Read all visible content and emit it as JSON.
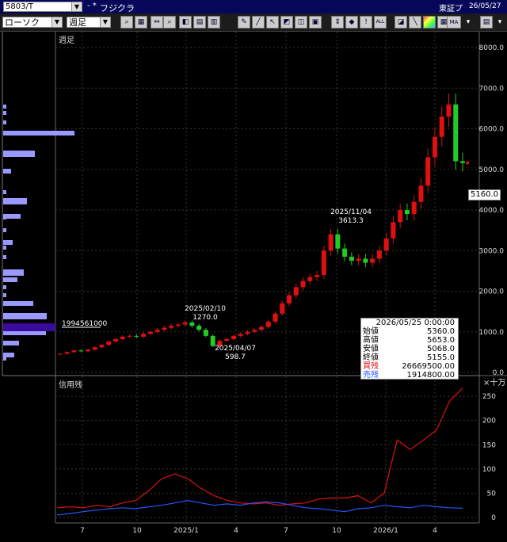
{
  "window": {
    "code": "5803/T",
    "marker": "- *",
    "company": "フジクラ",
    "exchange": "東証プ",
    "date": "26/05/27"
  },
  "toolbar": {
    "chart_type": "ローソク",
    "period": "週足",
    "extra_btn1": "MA"
  },
  "colors": {
    "background": "#000000",
    "up_candle": "#e01010",
    "down_candle": "#22cc22",
    "grid": "#333333",
    "sell_balance_line": "#e01010",
    "buy_balance_line": "#2255ff",
    "volume_profile": "#9999ff",
    "volume_profile_highlight": "#3a0a9a"
  },
  "main_chart": {
    "label": "週足",
    "y_ticks": [
      "8000.0",
      "7000.0",
      "6000.0",
      "5000.0",
      "4000.0",
      "3000.0",
      "2000.0",
      "1000.0",
      "0.0"
    ],
    "current_price": "5160.0",
    "volume_profile_value": "1994561000",
    "annotations": [
      {
        "date": "2025/02/10",
        "price": "1270.0"
      },
      {
        "date": "2025/04/07",
        "price": "598.7"
      },
      {
        "date": "2025/11/04",
        "price": "3613.3"
      }
    ]
  },
  "ohlc_box": {
    "date": "2026/05/25 0:00:00",
    "rows": [
      {
        "label": "始値",
        "value": "5360.0",
        "color": "#000000"
      },
      {
        "label": "高値",
        "value": "5653.0",
        "color": "#000000"
      },
      {
        "label": "安値",
        "value": "5068.0",
        "color": "#000000"
      },
      {
        "label": "終値",
        "value": "5155.0",
        "color": "#000000"
      },
      {
        "label": "買残",
        "value": "26669500.00",
        "color": "#e01010"
      },
      {
        "label": "売残",
        "value": "1914800.00",
        "color": "#2255ff"
      }
    ]
  },
  "sub_chart": {
    "label": "信用残",
    "unit": "×十万",
    "y_ticks": [
      "250",
      "200",
      "150",
      "100",
      "50",
      "0"
    ]
  },
  "x_axis": {
    "labels": [
      "7",
      "10",
      "2025/1",
      "4",
      "7",
      "10",
      "2026/1",
      "4"
    ]
  },
  "chart_data": [
    {
      "type": "candlestick",
      "title": "週足",
      "ylim": [
        0,
        8000
      ],
      "x": [
        "2024-07",
        "2024-10",
        "2025-01",
        "2025-04",
        "2025-07",
        "2025-10",
        "2026-01",
        "2026-04"
      ],
      "weekly_close_estimates": [
        460,
        500,
        540,
        520,
        560,
        620,
        680,
        760,
        820,
        880,
        900,
        880,
        950,
        1000,
        1050,
        1100,
        1150,
        1180,
        1230,
        1150,
        1050,
        900,
        650,
        780,
        820,
        900,
        950,
        1000,
        1050,
        1120,
        1250,
        1450,
        1700,
        1900,
        2100,
        2250,
        2350,
        2400,
        3000,
        3400,
        3050,
        2850,
        2750,
        2800,
        2700,
        2800,
        3000,
        3300,
        3700,
        4000,
        3900,
        4200,
        4600,
        5300,
        5800,
        6300,
        6600,
        5200,
        5155
      ],
      "annotations": [
        {
          "date": "2025/02/10",
          "value": 1270.0
        },
        {
          "date": "2025/04/07",
          "value": 598.7
        },
        {
          "date": "2025/11/04",
          "value": 3613.3
        }
      ],
      "last_price": 5160.0
    },
    {
      "type": "line",
      "title": "信用残",
      "ylabel": "×十万",
      "ylim": [
        0,
        260
      ],
      "series": [
        {
          "name": "買残",
          "values": [
            20,
            22,
            20,
            25,
            22,
            30,
            35,
            55,
            80,
            90,
            80,
            60,
            45,
            35,
            30,
            28,
            30,
            25,
            28,
            30,
            38,
            40,
            40,
            45,
            30,
            50,
            160,
            140,
            160,
            180,
            240,
            267
          ]
        },
        {
          "name": "売残",
          "values": [
            5,
            8,
            12,
            15,
            18,
            20,
            18,
            22,
            25,
            30,
            35,
            30,
            25,
            28,
            25,
            30,
            32,
            30,
            25,
            20,
            18,
            15,
            12,
            18,
            20,
            25,
            22,
            20,
            25,
            22,
            20,
            19
          ]
        }
      ]
    }
  ]
}
